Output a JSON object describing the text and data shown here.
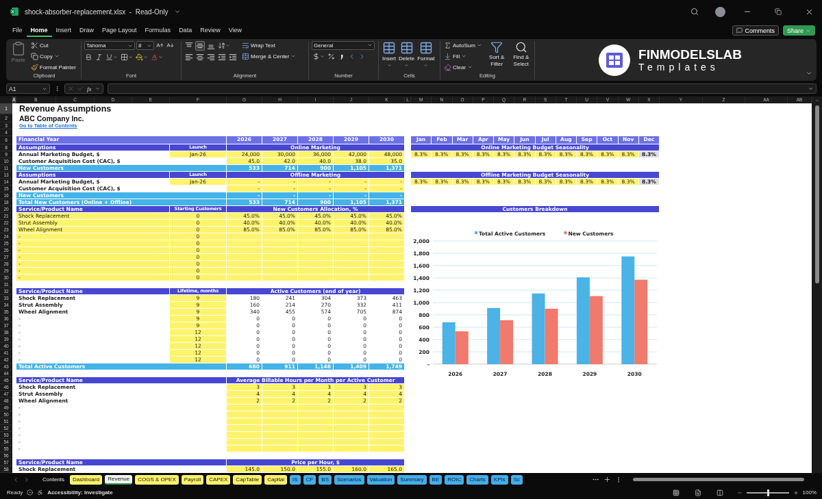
{
  "window": {
    "title": "shock-absorber-replacement.xlsx  -  Read-Only"
  },
  "menu": [
    {
      "label": "File",
      "selected": false
    },
    {
      "label": "Home",
      "selected": true
    },
    {
      "label": "Insert",
      "selected": false
    },
    {
      "label": "Draw",
      "selected": false
    },
    {
      "label": "Page Layout",
      "selected": false
    },
    {
      "label": "Formulas",
      "selected": false
    },
    {
      "label": "Data",
      "selected": false
    },
    {
      "label": "Review",
      "selected": false
    },
    {
      "label": "View",
      "selected": false
    }
  ],
  "actions": {
    "comments": "Comments",
    "share": "Share"
  },
  "ribbon": {
    "clipboard": {
      "label": "Clipboard",
      "paste": {
        "label": "Paste",
        "disabled": true
      },
      "cut": "Cut",
      "copy": "Copy",
      "format_painter": "Format Painter"
    },
    "font": {
      "label": "Font",
      "font_name": "Tahoma",
      "font_size": "8"
    },
    "alignment": {
      "label": "Alignment",
      "vertical": [
        {
          "selected": false
        },
        {
          "selected": true
        },
        {
          "selected": false
        }
      ],
      "wrap_text": "Wrap Text",
      "merge_center": "Merge & Center"
    },
    "number": {
      "label": "Number",
      "format": "General"
    },
    "cells": {
      "label": "Cells",
      "insert": "Insert",
      "delete": "Delete",
      "format": "Format"
    },
    "editing": {
      "label": "Editing",
      "autosum": "AutoSum",
      "fill": "Fill",
      "clear": "Clear",
      "sort_filter": "Sort & Filter",
      "find_select": "Find & Select"
    }
  },
  "logo": {
    "name": "FINMODELSLAB",
    "tagline": "Templates"
  },
  "formula_bar": {
    "name_box": "A1",
    "function_label": "fx"
  },
  "columns": [
    {
      "letter": "A",
      "selected": true
    },
    {
      "letter": "B",
      "selected": false
    },
    {
      "letter": "C",
      "selected": false
    },
    {
      "letter": "D",
      "selected": false
    },
    {
      "letter": "E",
      "selected": false
    },
    {
      "letter": "F",
      "selected": false
    },
    {
      "letter": "G",
      "selected": false
    },
    {
      "letter": "H",
      "selected": false
    },
    {
      "letter": "I",
      "selected": false
    },
    {
      "letter": "J",
      "selected": false
    },
    {
      "letter": "K",
      "selected": false
    },
    {
      "letter": "L",
      "selected": false
    },
    {
      "letter": "M",
      "selected": false
    },
    {
      "letter": "N",
      "selected": false
    },
    {
      "letter": "O",
      "selected": false
    },
    {
      "letter": "P",
      "selected": false
    },
    {
      "letter": "Q",
      "selected": false
    },
    {
      "letter": "R",
      "selected": false
    },
    {
      "letter": "S",
      "selected": false
    },
    {
      "letter": "T",
      "selected": false
    },
    {
      "letter": "U",
      "selected": false
    },
    {
      "letter": "V",
      "selected": false
    },
    {
      "letter": "W",
      "selected": false
    },
    {
      "letter": "X",
      "selected": false
    },
    {
      "letter": "Y",
      "selected": false
    },
    {
      "letter": "Z",
      "selected": false
    },
    {
      "letter": "AA",
      "selected": false
    },
    {
      "letter": "AB",
      "selected": false
    }
  ],
  "rows": [
    {
      "number": "1",
      "kind": "title",
      "selected": true,
      "label": "Revenue Assumptions"
    },
    {
      "number": "2",
      "kind": "subtitle",
      "selected": false,
      "label": "ABC Company Inc."
    },
    {
      "number": "3",
      "kind": "link",
      "selected": false,
      "label": "Go to Table of Contents"
    },
    {
      "number": "4",
      "kind": "blank",
      "selected": false
    },
    {
      "number": "6",
      "kind": "year-header",
      "selected": false,
      "label": "Financial Year",
      "years": [
        "2026",
        "2027",
        "2028",
        "2029",
        "2030"
      ],
      "right": {
        "kind": "months",
        "cells": [
          "Jan",
          "Feb",
          "Mar",
          "Apr",
          "May",
          "Jun",
          "Jul",
          "Aug",
          "Sep",
          "Oct",
          "Nov",
          "Dec"
        ]
      }
    },
    {
      "number": "8",
      "kind": "section-header",
      "selected": false,
      "label": "Assumptions",
      "column_f": "Launch",
      "years_title": "Online Marketing",
      "right": {
        "kind": "header",
        "text": "Online Marketing Budget Seasonality"
      }
    },
    {
      "number": "9",
      "kind": "data",
      "selected": false,
      "label": "Annual Marketing Budget, $",
      "bold": true,
      "label_input": false,
      "column_f": "Jan-26",
      "column_f_input": true,
      "years": [
        "24,000",
        "30,000",
        "36,000",
        "42,000",
        "48,000"
      ],
      "years_input": true,
      "right": {
        "kind": "values",
        "cells": [
          {
            "text": "8.3%",
            "input": true
          },
          {
            "text": "8.3%",
            "input": true
          },
          {
            "text": "8.3%",
            "input": true
          },
          {
            "text": "8.3%",
            "input": true
          },
          {
            "text": "8.3%",
            "input": true
          },
          {
            "text": "8.3%",
            "input": true
          },
          {
            "text": "8.3%",
            "input": true
          },
          {
            "text": "8.3%",
            "input": true
          },
          {
            "text": "8.3%",
            "input": true
          },
          {
            "text": "8.3%",
            "input": true
          },
          {
            "text": "8.3%",
            "input": true
          },
          {
            "text": "8.3%",
            "input": false
          }
        ]
      }
    },
    {
      "number": "10",
      "kind": "data",
      "selected": false,
      "label": "Customer Acquisition Cost (CAC), $",
      "bold": true,
      "label_input": false,
      "years": [
        "45.0",
        "42.0",
        "40.0",
        "38.0",
        "35.0"
      ],
      "years_input": true
    },
    {
      "number": "11",
      "kind": "total",
      "selected": false,
      "label": "New Customers",
      "years": [
        "533",
        "714",
        "900",
        "1,105",
        "1,371"
      ]
    },
    {
      "number": "13",
      "kind": "section-header",
      "selected": false,
      "label": "Assumptions",
      "column_f": "Launch",
      "years_title": "Offline Marketing",
      "right": {
        "kind": "header",
        "text": "Offline Marketing Budget Seasonality"
      }
    },
    {
      "number": "14",
      "kind": "data",
      "selected": false,
      "label": "Annual Marketing Budget, $",
      "bold": true,
      "label_input": false,
      "column_f": "Jan-26",
      "column_f_input": true,
      "years": [
        "-",
        "-",
        "-",
        "-",
        "-"
      ],
      "years_input": true,
      "right": {
        "kind": "values",
        "cells": [
          {
            "text": "8.3%",
            "input": true
          },
          {
            "text": "8.3%",
            "input": true
          },
          {
            "text": "8.3%",
            "input": true
          },
          {
            "text": "8.3%",
            "input": true
          },
          {
            "text": "8.3%",
            "input": true
          },
          {
            "text": "8.3%",
            "input": true
          },
          {
            "text": "8.3%",
            "input": true
          },
          {
            "text": "8.3%",
            "input": true
          },
          {
            "text": "8.3%",
            "input": true
          },
          {
            "text": "8.3%",
            "input": true
          },
          {
            "text": "8.3%",
            "input": true
          },
          {
            "text": "8.3%",
            "input": false
          }
        ]
      }
    },
    {
      "number": "15",
      "kind": "data",
      "selected": false,
      "label": "Customer Acquisition Cost (CAC), $",
      "bold": true,
      "label_input": false,
      "years": [
        "-",
        "-",
        "-",
        "-",
        "-"
      ],
      "years_input": true
    },
    {
      "number": "16",
      "kind": "total",
      "selected": false,
      "label": "New Customers",
      "years": [
        "-",
        "-",
        "-",
        "-",
        "-"
      ]
    },
    {
      "number": "18",
      "kind": "total",
      "selected": false,
      "label": "Total New Customers (Online + Offline)",
      "years": [
        "533",
        "714",
        "900",
        "1,105",
        "1,371"
      ]
    },
    {
      "number": "20",
      "kind": "section-header",
      "selected": false,
      "label": "Service/Product Name",
      "column_f": "Starting Customers",
      "years_title": "New Customers Allocation, %",
      "right": {
        "kind": "header",
        "text": "Customers Breakdown"
      }
    },
    {
      "number": "21",
      "kind": "data",
      "selected": false,
      "label": "Shock Replacement",
      "bold": false,
      "label_input": true,
      "column_f": "0",
      "column_f_input": true,
      "years": [
        "45.0%",
        "45.0%",
        "45.0%",
        "45.0%",
        "45.0%"
      ],
      "years_input": true
    },
    {
      "number": "22",
      "kind": "data",
      "selected": false,
      "label": "Strut Assembly",
      "bold": false,
      "label_input": true,
      "column_f": "0",
      "column_f_input": true,
      "years": [
        "40.0%",
        "40.0%",
        "40.0%",
        "40.0%",
        "40.0%"
      ],
      "years_input": true
    },
    {
      "number": "23",
      "kind": "data",
      "selected": false,
      "label": "Wheel Alignment",
      "bold": false,
      "label_input": true,
      "column_f": "0",
      "column_f_input": true,
      "years": [
        "85.0%",
        "85.0%",
        "85.0%",
        "85.0%",
        "85.0%"
      ],
      "years_input": true
    },
    {
      "number": "24",
      "kind": "data",
      "selected": false,
      "label": "-",
      "bold": false,
      "label_input": true,
      "column_f": "0",
      "column_f_input": true,
      "years_input": true
    },
    {
      "number": "25",
      "kind": "data",
      "selected": false,
      "label": "-",
      "bold": false,
      "label_input": true,
      "column_f": "0",
      "column_f_input": true,
      "years_input": true
    },
    {
      "number": "26",
      "kind": "data",
      "selected": false,
      "label": "-",
      "bold": false,
      "label_input": true,
      "column_f": "0",
      "column_f_input": true,
      "years_input": true
    },
    {
      "number": "27",
      "kind": "data",
      "selected": false,
      "label": "-",
      "bold": false,
      "label_input": true,
      "column_f": "0",
      "column_f_input": true,
      "years_input": true
    },
    {
      "number": "28",
      "kind": "data",
      "selected": false,
      "label": "-",
      "bold": false,
      "label_input": true,
      "column_f": "0",
      "column_f_input": true,
      "years_input": true
    },
    {
      "number": "29",
      "kind": "data",
      "selected": false,
      "label": "-",
      "bold": false,
      "label_input": true,
      "column_f": "0",
      "column_f_input": true,
      "years_input": true
    },
    {
      "number": "30",
      "kind": "data",
      "selected": false,
      "label": "-",
      "bold": false,
      "label_input": true,
      "column_f": "0",
      "column_f_input": true,
      "years_input": true
    },
    {
      "number": "31",
      "kind": "blank",
      "selected": false
    },
    {
      "number": "32",
      "kind": "section-header",
      "selected": false,
      "label": "Service/Product Name",
      "column_f": "Lifetime, months",
      "years_title": "Active Customers (end of year)"
    },
    {
      "number": "33",
      "kind": "data",
      "selected": false,
      "label": "Shock Replacement",
      "bold": true,
      "label_input": false,
      "column_f": "9",
      "column_f_input": true,
      "years": [
        "180",
        "241",
        "304",
        "373",
        "463"
      ],
      "years_input": false
    },
    {
      "number": "34",
      "kind": "data",
      "selected": false,
      "label": "Strut Assembly",
      "bold": true,
      "label_input": false,
      "column_f": "9",
      "column_f_input": true,
      "years": [
        "160",
        "214",
        "270",
        "332",
        "411"
      ],
      "years_input": false
    },
    {
      "number": "35",
      "kind": "data",
      "selected": false,
      "label": "Wheel Alignment",
      "bold": true,
      "label_input": false,
      "column_f": "9",
      "column_f_input": true,
      "years": [
        "340",
        "455",
        "574",
        "705",
        "874"
      ],
      "years_input": false
    },
    {
      "number": "36",
      "kind": "data",
      "selected": false,
      "label": "-",
      "bold": false,
      "label_input": false,
      "column_f": "9",
      "column_f_input": true,
      "years": [
        "0",
        "0",
        "0",
        "0",
        "0"
      ],
      "years_input": false
    },
    {
      "number": "37",
      "kind": "data",
      "selected": false,
      "label": "-",
      "bold": false,
      "label_input": false,
      "column_f": "9",
      "column_f_input": true,
      "years": [
        "0",
        "0",
        "0",
        "0",
        "0"
      ],
      "years_input": false
    },
    {
      "number": "38",
      "kind": "data",
      "selected": false,
      "label": "-",
      "bold": false,
      "label_input": false,
      "column_f": "12",
      "column_f_input": true,
      "years": [
        "0",
        "0",
        "0",
        "0",
        "0"
      ],
      "years_input": false
    },
    {
      "number": "39",
      "kind": "data",
      "selected": false,
      "label": "-",
      "bold": false,
      "label_input": false,
      "column_f": "12",
      "column_f_input": true,
      "years": [
        "0",
        "0",
        "0",
        "0",
        "0"
      ],
      "years_input": false
    },
    {
      "number": "40",
      "kind": "data",
      "selected": false,
      "label": "-",
      "bold": false,
      "label_input": false,
      "column_f": "12",
      "column_f_input": true,
      "years": [
        "0",
        "0",
        "0",
        "0",
        "0"
      ],
      "years_input": false
    },
    {
      "number": "41",
      "kind": "data",
      "selected": false,
      "label": "-",
      "bold": false,
      "label_input": false,
      "column_f": "12",
      "column_f_input": true,
      "years": [
        "0",
        "0",
        "0",
        "0",
        "0"
      ],
      "years_input": false
    },
    {
      "number": "42",
      "kind": "data",
      "selected": false,
      "label": "-",
      "bold": false,
      "label_input": false,
      "column_f": "12",
      "column_f_input": true,
      "years": [
        "0",
        "0",
        "0",
        "0",
        "0"
      ],
      "years_input": false
    },
    {
      "number": "43",
      "kind": "total",
      "selected": false,
      "label": "Total Active Customers",
      "years": [
        "680",
        "911",
        "1,148",
        "1,409",
        "1,749"
      ]
    },
    {
      "number": "44",
      "kind": "blank",
      "selected": false
    },
    {
      "number": "45",
      "kind": "section-header",
      "selected": false,
      "label": "Service/Product Name",
      "years_title": "Average Billable Hours per Month per Active Customer"
    },
    {
      "number": "46",
      "kind": "data",
      "selected": false,
      "label": "Shock Replacement",
      "bold": true,
      "label_input": false,
      "years": [
        "3",
        "3",
        "3",
        "3",
        "3"
      ],
      "years_input": true
    },
    {
      "number": "47",
      "kind": "data",
      "selected": false,
      "label": "Strut Assembly",
      "bold": true,
      "label_input": false,
      "years": [
        "4",
        "4",
        "4",
        "4",
        "4"
      ],
      "years_input": true
    },
    {
      "number": "48",
      "kind": "data",
      "selected": false,
      "label": "Wheel Alignment",
      "bold": true,
      "label_input": false,
      "years": [
        "2",
        "2",
        "2",
        "2",
        "2"
      ],
      "years_input": true
    },
    {
      "number": "49",
      "kind": "data",
      "selected": false,
      "label": "-",
      "bold": false,
      "label_input": false,
      "years_input": true
    },
    {
      "number": "50",
      "kind": "data",
      "selected": false,
      "label": "-",
      "bold": false,
      "label_input": false,
      "years_input": true
    },
    {
      "number": "51",
      "kind": "data",
      "selected": false,
      "label": "-",
      "bold": false,
      "label_input": false,
      "years_input": true
    },
    {
      "number": "52",
      "kind": "data",
      "selected": false,
      "label": "-",
      "bold": false,
      "label_input": false,
      "years_input": true
    },
    {
      "number": "53",
      "kind": "data",
      "selected": false,
      "label": "-",
      "bold": false,
      "label_input": false,
      "years_input": true
    },
    {
      "number": "54",
      "kind": "data",
      "selected": false,
      "label": "-",
      "bold": false,
      "label_input": false,
      "years_input": true
    },
    {
      "number": "55",
      "kind": "data",
      "selected": false,
      "label": "-",
      "bold": false,
      "label_input": false,
      "years_input": true
    },
    {
      "number": "56",
      "kind": "blank",
      "selected": false
    },
    {
      "number": "57",
      "kind": "section-header",
      "selected": false,
      "label": "Service/Product Name",
      "years_title": "Price per Hour, $"
    },
    {
      "number": "58",
      "kind": "data",
      "selected": false,
      "label": "Shock Replacement",
      "bold": true,
      "label_input": false,
      "years": [
        "145.0",
        "150.0",
        "155.0",
        "160.0",
        "165.0"
      ],
      "years_input": true
    }
  ],
  "chart": {
    "chart_data": {
      "type": "bar",
      "grid": true,
      "legend": "top",
      "categories": [
        "2026",
        "2027",
        "2028",
        "2029",
        "2030"
      ],
      "series": [
        {
          "name": "Total Active Customers",
          "color": "#4bb3e6",
          "values": [
            680,
            911,
            1148,
            1409,
            1749
          ]
        },
        {
          "name": "New Customers",
          "color": "#ef7a6d",
          "values": [
            533,
            714,
            900,
            1105,
            1371
          ]
        }
      ],
      "ylim": [
        0,
        2000
      ],
      "yticks": [
        {
          "value": 0,
          "label": "-"
        },
        {
          "value": 200,
          "label": "200"
        },
        {
          "value": 400,
          "label": "400"
        },
        {
          "value": 600,
          "label": "600"
        },
        {
          "value": 800,
          "label": "800"
        },
        {
          "value": 1000,
          "label": "1,000"
        },
        {
          "value": 1200,
          "label": "1,200"
        },
        {
          "value": 1400,
          "label": "1,400"
        },
        {
          "value": 1600,
          "label": "1,600"
        },
        {
          "value": 1800,
          "label": "1,800"
        },
        {
          "value": 2000,
          "label": "2,000"
        }
      ]
    }
  },
  "sheet_tabs": [
    {
      "label": "Contents",
      "selected": false
    },
    {
      "label": "Dashboard",
      "selected": false,
      "color": "#fff36b"
    },
    {
      "label": "Revenue",
      "selected": true
    },
    {
      "label": "COGS & OPEX",
      "selected": false,
      "color": "#fff36b"
    },
    {
      "label": "Payroll",
      "selected": false,
      "color": "#fff36b"
    },
    {
      "label": "CAPEX",
      "selected": false,
      "color": "#fff36b"
    },
    {
      "label": "CapTable",
      "selected": false,
      "color": "#fff36b"
    },
    {
      "label": "Capital",
      "selected": false,
      "color": "#fff36b"
    },
    {
      "label": "IS",
      "selected": false,
      "color": "#45aee8"
    },
    {
      "label": "CF",
      "selected": false,
      "color": "#45aee8"
    },
    {
      "label": "BS",
      "selected": false,
      "color": "#45aee8"
    },
    {
      "label": "Scenarios",
      "selected": false,
      "color": "#45aee8"
    },
    {
      "label": "Valuation",
      "selected": false,
      "color": "#45aee8"
    },
    {
      "label": "Summary",
      "selected": false,
      "color": "#45aee8"
    },
    {
      "label": "BE",
      "selected": false,
      "color": "#45aee8"
    },
    {
      "label": "ROIC",
      "selected": false,
      "color": "#45aee8"
    },
    {
      "label": "Charts",
      "selected": false,
      "color": "#45aee8"
    },
    {
      "label": "KPIs",
      "selected": false,
      "color": "#45aee8"
    },
    {
      "label": "Sc",
      "selected": false,
      "color": "#45aee8"
    }
  ],
  "status_bar": {
    "state": "Ready",
    "accessibility": "Accessibility: Investigate",
    "zoom": {
      "level": 0.5,
      "reading": "100%"
    }
  }
}
